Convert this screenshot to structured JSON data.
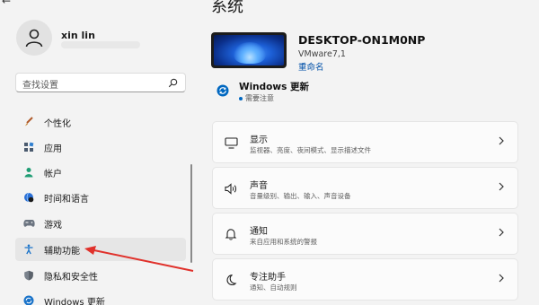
{
  "nav": {
    "back_icon": "back-arrow-icon",
    "back_glyph": "←"
  },
  "user": {
    "name": "xin lin"
  },
  "search": {
    "placeholder": "查找设置"
  },
  "sidebar": {
    "items": [
      {
        "label": "个性化",
        "icon": "brush-icon"
      },
      {
        "label": "应用",
        "icon": "apps-icon"
      },
      {
        "label": "帐户",
        "icon": "account-icon"
      },
      {
        "label": "时间和语言",
        "icon": "globe-clock-icon"
      },
      {
        "label": "游戏",
        "icon": "gamepad-icon"
      },
      {
        "label": "辅助功能",
        "icon": "accessibility-icon",
        "active": true
      },
      {
        "label": "隐私和安全性",
        "icon": "shield-icon"
      },
      {
        "label": "Windows 更新",
        "icon": "update-icon"
      }
    ]
  },
  "page": {
    "title": "系统"
  },
  "device": {
    "name": "DESKTOP-ON1M0NP",
    "model": "VMware7,1",
    "rename_label": "重命名"
  },
  "windows_update": {
    "title": "Windows 更新",
    "status": "需要注意"
  },
  "cards": [
    {
      "title": "显示",
      "subtitle": "监视器、亮度、夜间模式、显示描述文件",
      "icon": "monitor-icon"
    },
    {
      "title": "声音",
      "subtitle": "音量级别、输出、输入、声音设备",
      "icon": "speaker-icon"
    },
    {
      "title": "通知",
      "subtitle": "来自应用和系统的警报",
      "icon": "bell-icon"
    },
    {
      "title": "专注助手",
      "subtitle": "通知、自动规则",
      "icon": "moon-icon"
    }
  ],
  "colors": {
    "accent": "#0067c0",
    "annotation_arrow": "#e0312b"
  }
}
